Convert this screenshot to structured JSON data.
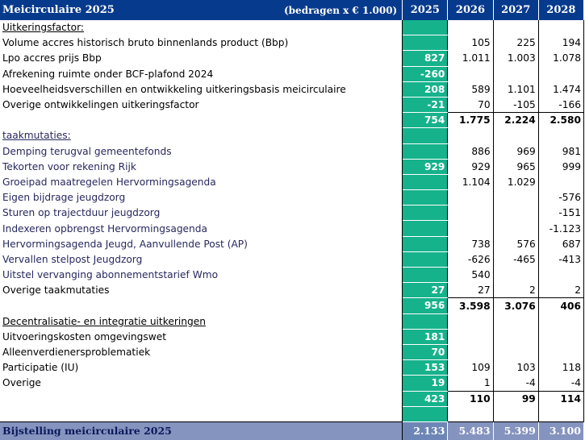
{
  "header": {
    "title": "Meicirculaire 2025",
    "unit": "(bedragen x € 1.000)",
    "years": [
      "2025",
      "2026",
      "2027",
      "2028"
    ]
  },
  "rows": [
    {
      "label": "Uitkeringsfactor:",
      "type": "section",
      "values": [
        "",
        "",
        "",
        ""
      ]
    },
    {
      "label": "Volume accres historisch bruto binnenlands product (Bbp)",
      "type": "item",
      "values": [
        "",
        "105",
        "225",
        "194"
      ]
    },
    {
      "label": "Lpo accres prijs Bbp",
      "type": "item",
      "values": [
        "827",
        "1.011",
        "1.003",
        "1.078"
      ]
    },
    {
      "label": "Afrekening ruimte onder BCF-plafond 2024",
      "type": "item",
      "values": [
        "-260",
        "",
        "",
        ""
      ]
    },
    {
      "label": "Hoeveelheidsverschillen en ontwikkeling uitkeringsbasis meicirculaire",
      "type": "item",
      "values": [
        "208",
        "589",
        "1.101",
        "1.474"
      ]
    },
    {
      "label": "Overige ontwikkelingen uitkeringsfactor",
      "type": "item",
      "values": [
        "-21",
        "70",
        "-105",
        "-166"
      ]
    },
    {
      "label": "",
      "type": "subtotal",
      "values": [
        "754",
        "1.775",
        "2.224",
        "2.580"
      ]
    },
    {
      "label": "taakmutaties:",
      "type": "section",
      "color": "#27285e",
      "values": [
        "",
        "",
        "",
        ""
      ]
    },
    {
      "label": "Demping terugval gemeentefonds",
      "type": "item",
      "color": "#27285e",
      "values": [
        "",
        "886",
        "969",
        "981"
      ]
    },
    {
      "label": "Tekorten voor rekening Rijk",
      "type": "item",
      "color": "#27285e",
      "values": [
        "929",
        "929",
        "965",
        "999"
      ]
    },
    {
      "label": "Groeipad maatregelen Hervormingsagenda",
      "type": "item",
      "color": "#27285e",
      "values": [
        "",
        "1.104",
        "1.029",
        ""
      ]
    },
    {
      "label": "Eigen bijdrage jeugdzorg",
      "type": "item",
      "color": "#27285e",
      "values": [
        "",
        "",
        "",
        "-576"
      ]
    },
    {
      "label": "Sturen op trajectduur jeugdzorg",
      "type": "item",
      "color": "#27285e",
      "values": [
        "",
        "",
        "",
        "-151"
      ]
    },
    {
      "label": "Indexeren opbrengst Hervormingsagenda",
      "type": "item",
      "color": "#27285e",
      "values": [
        "",
        "",
        "",
        "-1.123"
      ]
    },
    {
      "label": "Hervormingsagenda Jeugd, Aanvullende Post (AP)",
      "type": "item",
      "color": "#27285e",
      "values": [
        "",
        "738",
        "576",
        "687"
      ]
    },
    {
      "label": "Vervallen stelpost Jeugdzorg",
      "type": "item",
      "color": "#27285e",
      "values": [
        "",
        "-626",
        "-465",
        "-413"
      ]
    },
    {
      "label": "Uitstel vervanging abonnementstarief Wmo",
      "type": "item",
      "color": "#27285e",
      "values": [
        "",
        "540",
        "",
        ""
      ]
    },
    {
      "label": "Overige taakmutaties",
      "type": "item",
      "values": [
        "27",
        "27",
        "2",
        "2"
      ]
    },
    {
      "label": "",
      "type": "subtotal",
      "values": [
        "956",
        "3.598",
        "3.076",
        "406"
      ]
    },
    {
      "label": "Decentralisatie- en integratie uitkeringen",
      "type": "section",
      "values": [
        "",
        "",
        "",
        ""
      ]
    },
    {
      "label": "Uitvoeringskosten omgevingswet",
      "type": "item",
      "values": [
        "181",
        "",
        "",
        ""
      ]
    },
    {
      "label": "Alleenverdienersproblematiek",
      "type": "item",
      "values": [
        "70",
        "",
        "",
        ""
      ]
    },
    {
      "label": "Participatie (IU)",
      "type": "item",
      "values": [
        "153",
        "109",
        "103",
        "118"
      ]
    },
    {
      "label": "Overige",
      "type": "item",
      "values": [
        "19",
        "1",
        "-4",
        "-4"
      ]
    },
    {
      "label": "",
      "type": "subtotal",
      "values": [
        "423",
        "110",
        "99",
        "114"
      ]
    },
    {
      "label": "",
      "type": "blank",
      "values": [
        "",
        "",
        "",
        ""
      ]
    }
  ],
  "footer": {
    "label": "Bijstelling meicirculaire 2025",
    "values": [
      "2.133",
      "5.483",
      "5.399",
      "3.100"
    ]
  },
  "colors": {
    "header_bg": "#063a8c",
    "col2025_bg": "#16b28c",
    "footer_bg": "#8593bf",
    "footer_2025_bg": "#6d86b5",
    "blue_text": "#27285e"
  }
}
